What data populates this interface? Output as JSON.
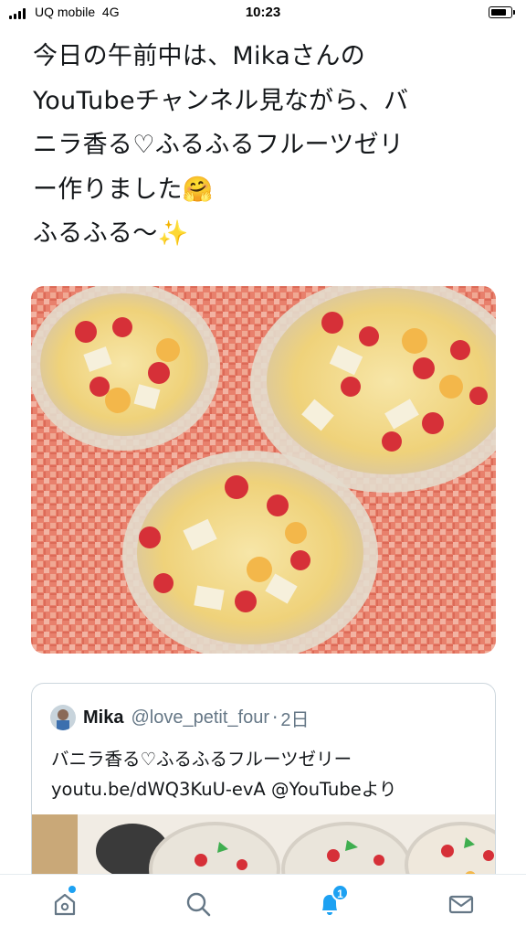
{
  "status_bar": {
    "carrier": "UQ mobile",
    "network": "4G",
    "time": "10:23"
  },
  "tweet": {
    "text": "今日の午前中は、Mikaさんの\nYouTubeチャンネル見ながら、バ\nニラ香る♡ふるふるフルーツゼリ\nー作りました🤗\nふるふる〜✨"
  },
  "quote": {
    "name": "Mika",
    "handle": "@love_petit_four",
    "separator": "·",
    "time": "2日",
    "text": "バニラ香る♡ふるふるフルーツゼリー\nyoutu.be/dWQ3KuU-evA @YouTubeより"
  },
  "tab_bar": {
    "tabs": [
      "home-icon",
      "search-icon",
      "notifications-icon",
      "messages-icon"
    ],
    "notification_count": "1"
  },
  "colors": {
    "accent": "#1da1f2",
    "text": "#14171a",
    "muted": "#657786",
    "border": "#ccd6dd"
  }
}
